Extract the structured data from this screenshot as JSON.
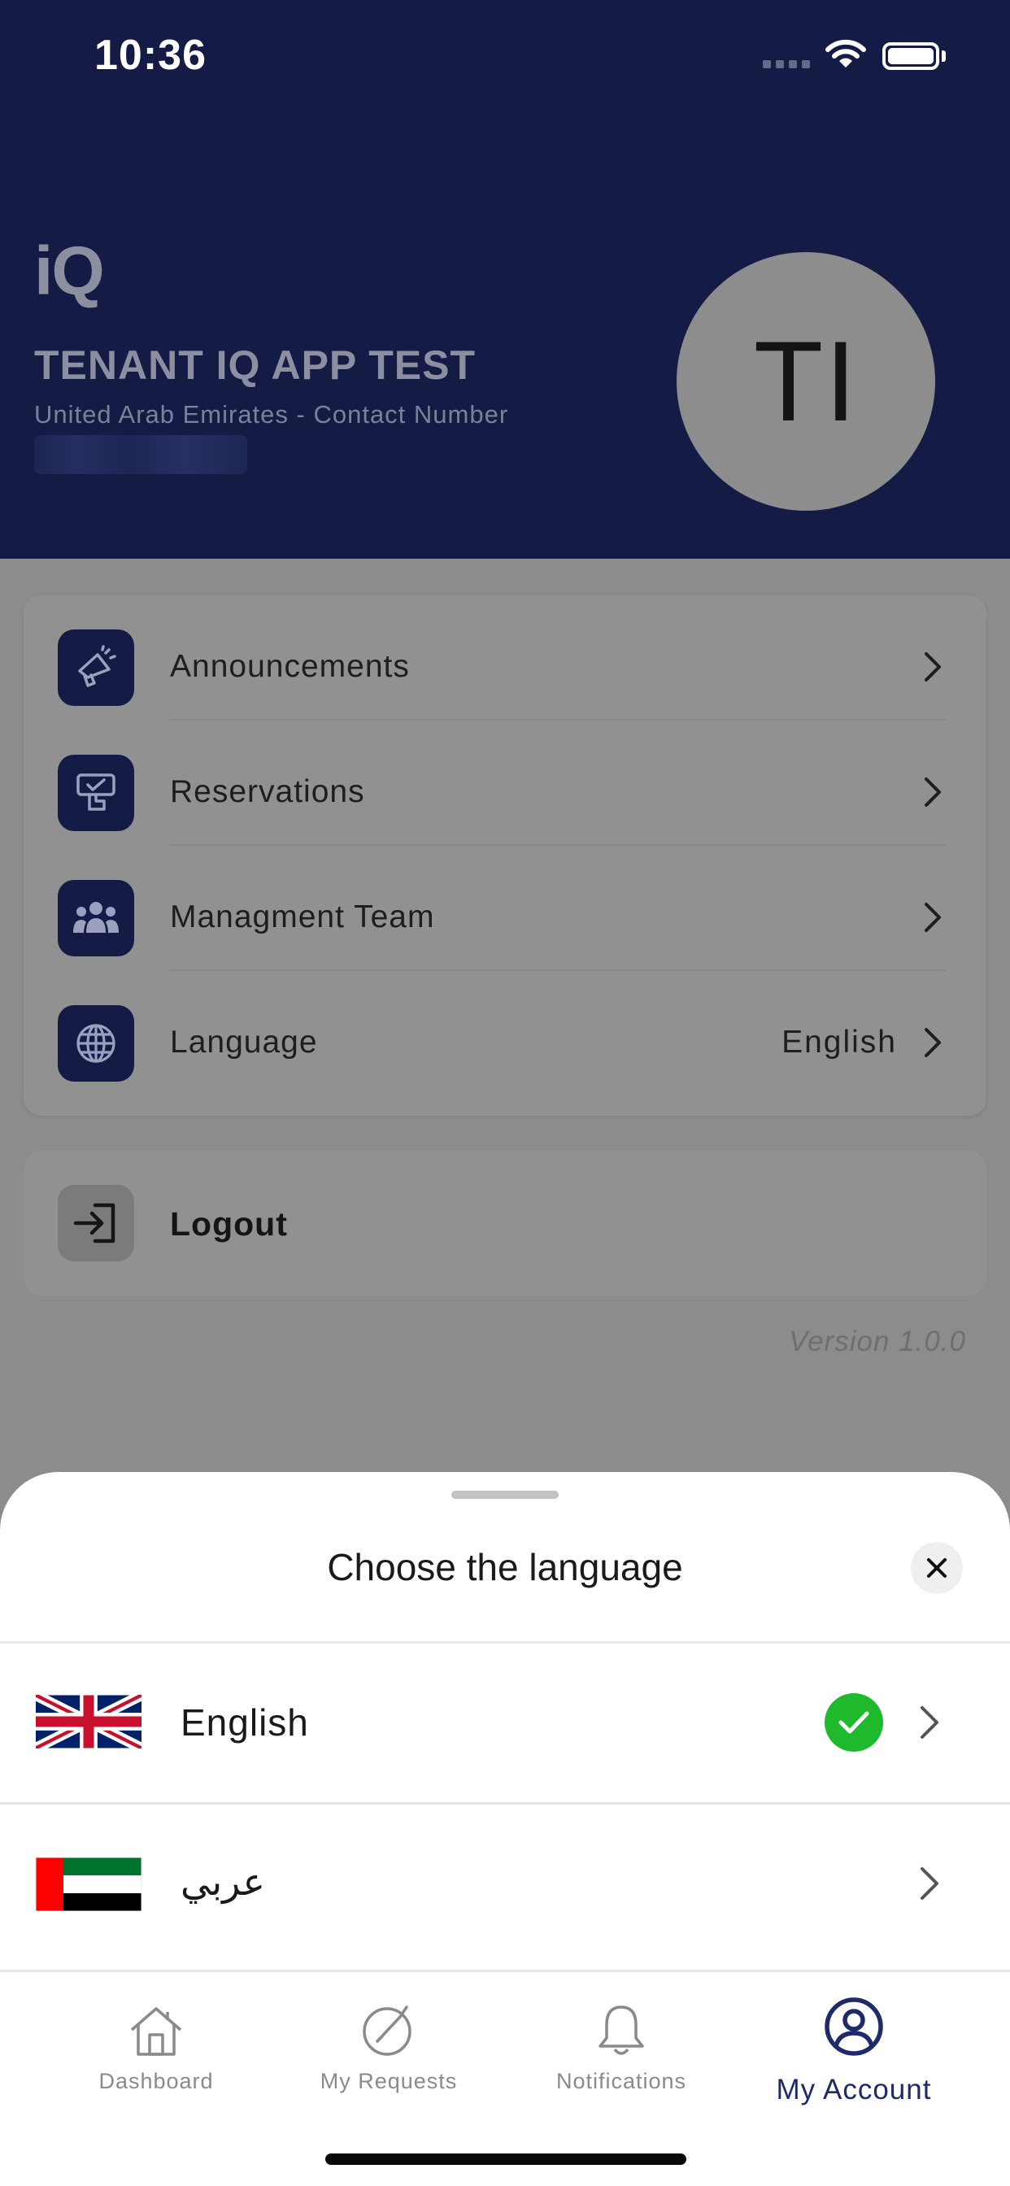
{
  "status_bar": {
    "time": "10:36"
  },
  "header": {
    "logo": "iQ",
    "tenant_name": "TENANT IQ APP TEST",
    "country_contact": "United Arab Emirates - Contact Number",
    "avatar_initials": "TI"
  },
  "menu": {
    "items": [
      {
        "label": "Announcements",
        "icon": "megaphone-icon"
      },
      {
        "label": "Reservations",
        "icon": "reservation-icon"
      },
      {
        "label": "Managment Team",
        "icon": "team-icon"
      },
      {
        "label": "Language",
        "icon": "globe-icon",
        "value": "English"
      }
    ],
    "logout_label": "Logout",
    "version": "Version 1.0.0"
  },
  "language_sheet": {
    "title": "Choose the language",
    "options": [
      {
        "label": "English",
        "flag": "uk-flag",
        "selected": true
      },
      {
        "label": "عربي",
        "flag": "uae-flag",
        "selected": false
      }
    ]
  },
  "tab_bar": {
    "tabs": [
      {
        "label": "Dashboard",
        "icon": "home-icon"
      },
      {
        "label": "My Requests",
        "icon": "requests-icon"
      },
      {
        "label": "Notifications",
        "icon": "bell-icon"
      },
      {
        "label": "My Account",
        "icon": "account-icon",
        "active": true
      }
    ]
  },
  "colors": {
    "brand_navy": "#141c46",
    "success_green": "#1fb92e",
    "active_tab": "#1f2a6b"
  }
}
